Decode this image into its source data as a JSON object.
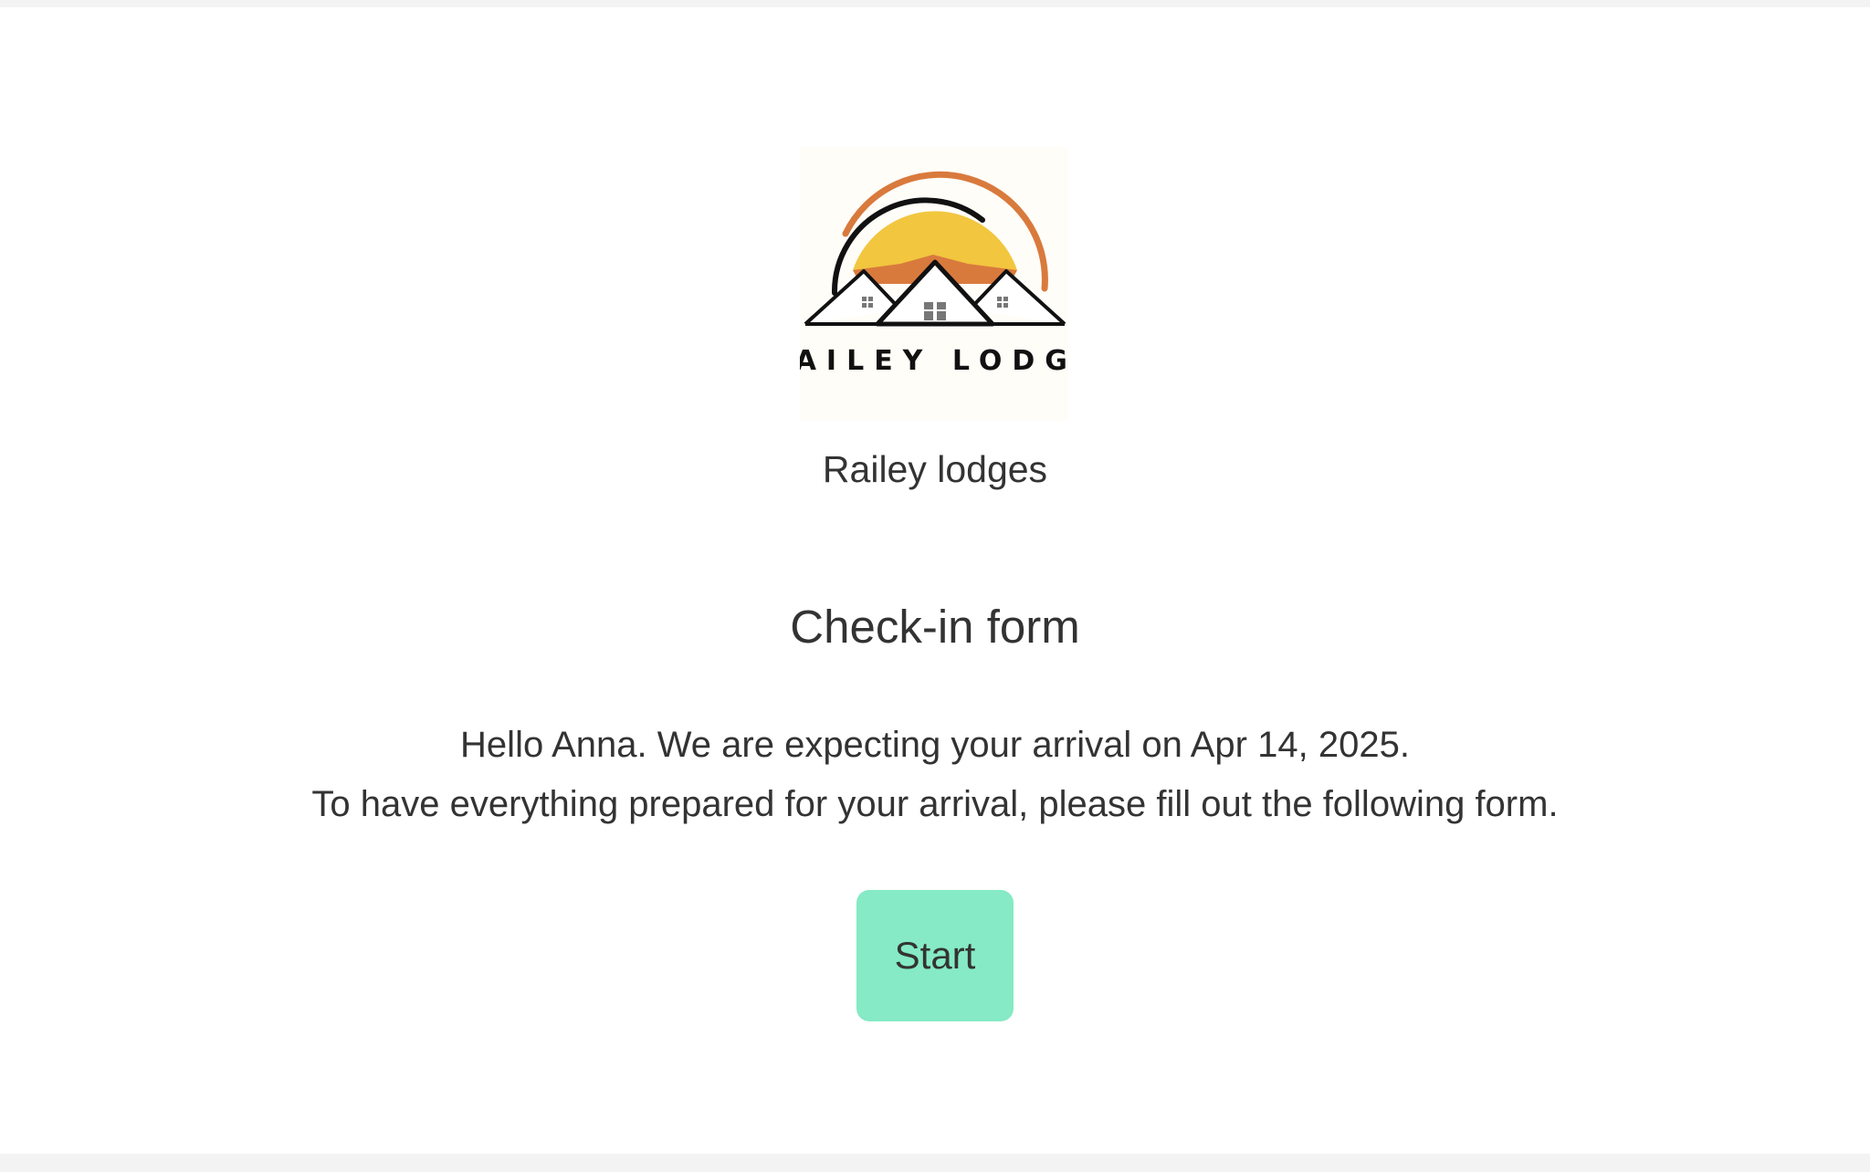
{
  "brand": {
    "logo_text": "RAILEY LODGE",
    "name": "Railey lodges"
  },
  "form": {
    "title": "Check-in form",
    "greeting": "Hello Anna. We are expecting your arrival on Apr 14, 2025.",
    "instructions": "To have everything prepared for your arrival, please fill out the following form.",
    "start_label": "Start"
  },
  "colors": {
    "page_background": "#f3f3f3",
    "card_background": "#ffffff",
    "text": "#333333",
    "start_button": "#85eac5",
    "logo_sun": "#f2c63f",
    "logo_arc": "#d97a3d"
  }
}
